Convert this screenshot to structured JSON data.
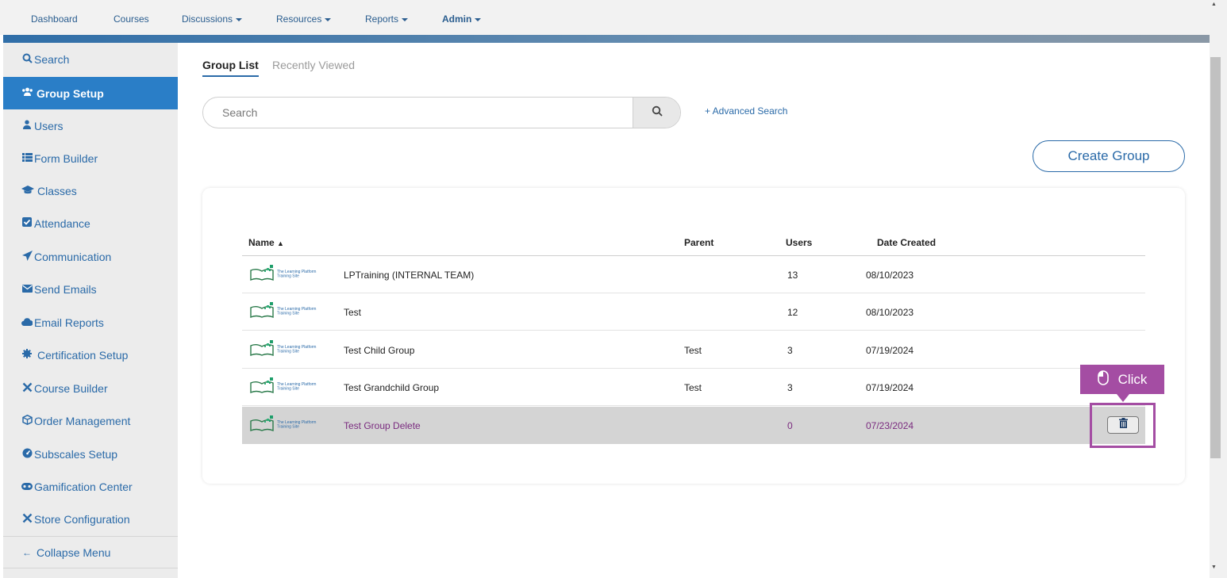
{
  "topnav": {
    "items": [
      {
        "label": "Dashboard",
        "dropdown": false,
        "bold": false
      },
      {
        "label": "Courses",
        "dropdown": false,
        "bold": false
      },
      {
        "label": "Discussions",
        "dropdown": true,
        "bold": false
      },
      {
        "label": "Resources",
        "dropdown": true,
        "bold": false
      },
      {
        "label": "Reports",
        "dropdown": true,
        "bold": false
      },
      {
        "label": "Admin",
        "dropdown": true,
        "bold": true
      }
    ]
  },
  "sidebar": {
    "items": [
      {
        "icon": "search-icon",
        "label": "Search",
        "active": false
      },
      {
        "icon": "users-group-icon",
        "label": "Group Setup",
        "active": true
      },
      {
        "icon": "user-icon",
        "label": "Users",
        "active": false
      },
      {
        "icon": "list-icon",
        "label": "Form Builder",
        "active": false
      },
      {
        "icon": "graduation-cap-icon",
        "label": "Classes",
        "active": false
      },
      {
        "icon": "checkbox-icon",
        "label": "Attendance",
        "active": false
      },
      {
        "icon": "paper-plane-icon",
        "label": "Communication",
        "active": false
      },
      {
        "icon": "envelope-icon",
        "label": "Send Emails",
        "active": false
      },
      {
        "icon": "cloud-icon",
        "label": "Email Reports",
        "active": false
      },
      {
        "icon": "certificate-icon",
        "label": "Certification Setup",
        "active": false
      },
      {
        "icon": "tools-icon",
        "label": "Course Builder",
        "active": false
      },
      {
        "icon": "box-icon",
        "label": "Order Management",
        "active": false
      },
      {
        "icon": "dashboard-icon",
        "label": "Subscales Setup",
        "active": false
      },
      {
        "icon": "gamepad-icon",
        "label": "Gamification Center",
        "active": false
      },
      {
        "icon": "tools-icon",
        "label": "Store Configuration",
        "active": false
      }
    ],
    "collapse_label": "Collapse Menu"
  },
  "tabs": {
    "active": "Group List",
    "inactive": "Recently Viewed"
  },
  "search": {
    "placeholder": "Search",
    "advanced_label": "+ Advanced Search"
  },
  "create_label": "Create Group",
  "table": {
    "headers": {
      "name": "Name",
      "parent": "Parent",
      "users": "Users",
      "date": "Date Created"
    },
    "logo_text": [
      "The Learning Platform",
      "Training Site"
    ],
    "rows": [
      {
        "name": "LPTraining (INTERNAL TEAM)",
        "parent": "",
        "users": "13",
        "date": "08/10/2023"
      },
      {
        "name": "Test",
        "parent": "",
        "users": "12",
        "date": "08/10/2023"
      },
      {
        "name": "Test Child Group",
        "parent": "Test",
        "users": "3",
        "date": "07/19/2024"
      },
      {
        "name": "Test Grandchild Group",
        "parent": "Test",
        "users": "3",
        "date": "07/19/2024"
      },
      {
        "name": "Test Group Delete",
        "parent": "",
        "users": "0",
        "date": "07/23/2024",
        "selected": true
      }
    ]
  },
  "tooltip": {
    "label": "Click",
    "color": "#a44da3"
  },
  "colors": {
    "accent": "#2a7ec7",
    "link": "#2a6aa8",
    "highlight": "#a44da3"
  }
}
